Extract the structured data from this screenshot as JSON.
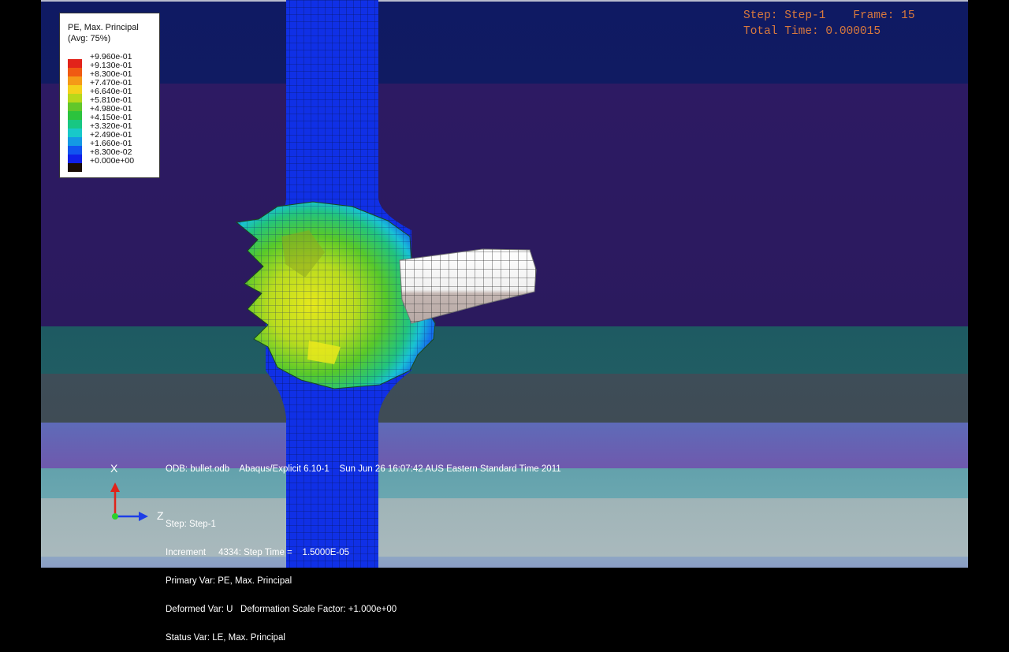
{
  "legend": {
    "title_line1": "PE, Max. Principal",
    "title_line2": "(Avg: 75%)",
    "entries": [
      {
        "label": "+9.960e-01",
        "color": "#ffffff"
      },
      {
        "label": "+9.130e-01",
        "color": "#e2231a"
      },
      {
        "label": "+8.300e-01",
        "color": "#f05a12"
      },
      {
        "label": "+7.470e-01",
        "color": "#f59a17"
      },
      {
        "label": "+6.640e-01",
        "color": "#f4d11b"
      },
      {
        "label": "+5.810e-01",
        "color": "#b8d81b"
      },
      {
        "label": "+4.980e-01",
        "color": "#62c72a"
      },
      {
        "label": "+4.150e-01",
        "color": "#2cc33d"
      },
      {
        "label": "+3.320e-01",
        "color": "#18c783"
      },
      {
        "label": "+2.490e-01",
        "color": "#18c9c9"
      },
      {
        "label": "+1.660e-01",
        "color": "#1499e4"
      },
      {
        "label": "+8.300e-02",
        "color": "#1154f0"
      },
      {
        "label": "+0.000e+00",
        "color": "#1020e8"
      },
      {
        "label": "",
        "color": "#1a0d05"
      }
    ]
  },
  "frame_info": {
    "step_label": "Step:",
    "step_value": "Step-1",
    "frame_label": "Frame:",
    "frame_value": "15",
    "time_label": "Total Time:",
    "time_value": "0.000015"
  },
  "triad": {
    "x_axis": "X",
    "z_axis": "Z"
  },
  "odb_line": "ODB: bullet.odb    Abaqus/Explicit 6.10-1    Sun Jun 26 16:07:42 AUS Eastern Standard Time 2011",
  "step_info": {
    "line1": "Step: Step-1",
    "line2": "Increment     4334: Step Time =    1.5000E-05",
    "line3": "Primary Var: PE, Max. Principal",
    "line4": "Deformed Var: U   Deformation Scale Factor: +1.000e+00",
    "line5": "Status Var: LE, Max. Principal"
  },
  "colors": {
    "rod_blue": "#1030e6",
    "plastic_green": "#4fc72a",
    "bullet_white": "#f2f2f2",
    "annotation_orange": "#d9793d"
  }
}
